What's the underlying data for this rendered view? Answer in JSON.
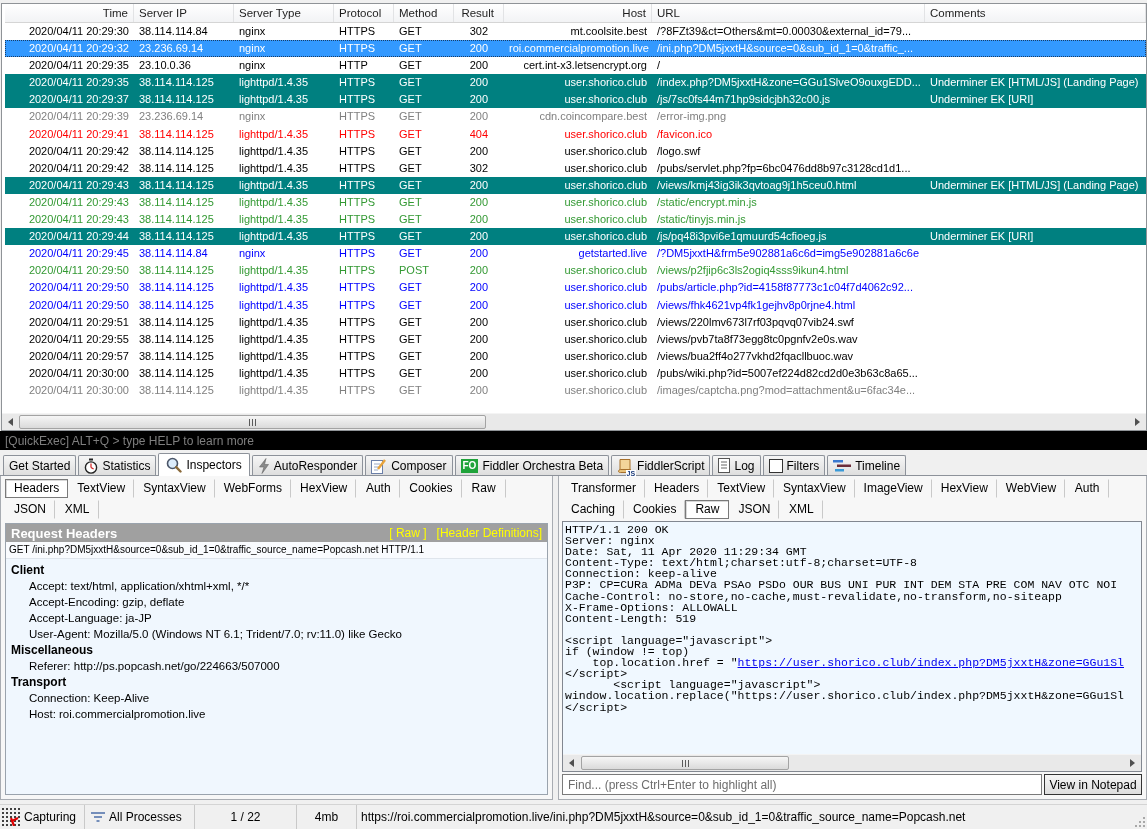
{
  "sessions": {
    "columns": [
      "Time",
      "Server IP",
      "Server Type",
      "Protocol",
      "Method",
      "Result",
      "Host",
      "URL",
      "Comments"
    ],
    "rows": [
      {
        "time": "2020/04/11 20:29:30",
        "server_ip": "38.114.114.84",
        "server_type": "nginx",
        "protocol": "HTTPS",
        "method": "GET",
        "result": "302",
        "host": "mt.coolsite.best",
        "url": "/?8FZt39&ct=Others&mt=0.00030&external_id=79...",
        "selected": false,
        "marked": false,
        "color": "#000000"
      },
      {
        "time": "2020/04/11 20:29:32",
        "server_ip": "23.236.69.14",
        "server_type": "nginx",
        "protocol": "HTTPS",
        "method": "GET",
        "result": "200",
        "host": "roi.commercialpromotion.live",
        "url": "/ini.php?DM5jxxtH&source=0&sub_id_1=0&traffic_...",
        "selected": true,
        "marked": false
      },
      {
        "time": "2020/04/11 20:29:35",
        "server_ip": "23.10.0.36",
        "server_type": "nginx",
        "protocol": "HTTP",
        "method": "GET",
        "result": "200",
        "host": "cert.int-x3.letsencrypt.org",
        "url": "/",
        "selected": false,
        "marked": false,
        "color": "#000000"
      },
      {
        "time": "2020/04/11 20:29:35",
        "server_ip": "38.114.114.125",
        "server_type": "lighttpd/1.4.35",
        "protocol": "HTTPS",
        "method": "GET",
        "result": "200",
        "host": "user.shorico.club",
        "url": "/index.php?DM5jxxtH&zone=GGu1SlveO9ouxgEDD...",
        "comments": "Underminer EK [HTML/JS] (Landing Page)",
        "selected": false,
        "marked": true,
        "color": "#008080"
      },
      {
        "time": "2020/04/11 20:29:37",
        "server_ip": "38.114.114.125",
        "server_type": "lighttpd/1.4.35",
        "protocol": "HTTPS",
        "method": "GET",
        "result": "200",
        "host": "user.shorico.club",
        "url": "/js/7sc0fs44m71hp9sidcjbh32c00.js",
        "comments": "Underminer EK [URI]",
        "selected": false,
        "marked": true,
        "color": "#008080"
      },
      {
        "time": "2020/04/11 20:29:39",
        "server_ip": "23.236.69.14",
        "server_type": "nginx",
        "protocol": "HTTPS",
        "method": "GET",
        "result": "200",
        "host": "cdn.coincompare.best",
        "url": "/error-img.png",
        "selected": false,
        "marked": false,
        "color": "#808080"
      },
      {
        "time": "2020/04/11 20:29:41",
        "server_ip": "38.114.114.125",
        "server_type": "lighttpd/1.4.35",
        "protocol": "HTTPS",
        "method": "GET",
        "result": "404",
        "host": "user.shorico.club",
        "url": "/favicon.ico",
        "selected": false,
        "marked": false,
        "color": "#ff0000"
      },
      {
        "time": "2020/04/11 20:29:42",
        "server_ip": "38.114.114.125",
        "server_type": "lighttpd/1.4.35",
        "protocol": "HTTPS",
        "method": "GET",
        "result": "200",
        "host": "user.shorico.club",
        "url": "/logo.swf",
        "selected": false,
        "marked": false,
        "color": "#000000"
      },
      {
        "time": "2020/04/11 20:29:42",
        "server_ip": "38.114.114.125",
        "server_type": "lighttpd/1.4.35",
        "protocol": "HTTPS",
        "method": "GET",
        "result": "302",
        "host": "user.shorico.club",
        "url": "/pubs/servlet.php?fp=6bc0476dd8b97c3128cd1d1...",
        "selected": false,
        "marked": false,
        "color": "#000000"
      },
      {
        "time": "2020/04/11 20:29:43",
        "server_ip": "38.114.114.125",
        "server_type": "lighttpd/1.4.35",
        "protocol": "HTTPS",
        "method": "GET",
        "result": "200",
        "host": "user.shorico.club",
        "url": "/views/kmj43ig3ik3qvtoag9j1h5ceu0.html",
        "comments": "Underminer EK [HTML/JS] (Landing Page)",
        "selected": false,
        "marked": true,
        "color": "#008080"
      },
      {
        "time": "2020/04/11 20:29:43",
        "server_ip": "38.114.114.125",
        "server_type": "lighttpd/1.4.35",
        "protocol": "HTTPS",
        "method": "GET",
        "result": "200",
        "host": "user.shorico.club",
        "url": "/static/encrypt.min.js",
        "selected": false,
        "marked": false,
        "color": "#339933"
      },
      {
        "time": "2020/04/11 20:29:43",
        "server_ip": "38.114.114.125",
        "server_type": "lighttpd/1.4.35",
        "protocol": "HTTPS",
        "method": "GET",
        "result": "200",
        "host": "user.shorico.club",
        "url": "/static/tinyjs.min.js",
        "selected": false,
        "marked": false,
        "color": "#339933"
      },
      {
        "time": "2020/04/11 20:29:44",
        "server_ip": "38.114.114.125",
        "server_type": "lighttpd/1.4.35",
        "protocol": "HTTPS",
        "method": "GET",
        "result": "200",
        "host": "user.shorico.club",
        "url": "/js/pq48i3pvi6e1qmuurd54cfioeg.js",
        "comments": "Underminer EK [URI]",
        "selected": false,
        "marked": true,
        "color": "#008080"
      },
      {
        "time": "2020/04/11 20:29:45",
        "server_ip": "38.114.114.84",
        "server_type": "nginx",
        "protocol": "HTTPS",
        "method": "GET",
        "result": "200",
        "host": "getstarted.live",
        "url": "/?DM5jxxtH&frm5e902881a6c6d=img5e902881a6c6e",
        "selected": false,
        "marked": false,
        "color": "#0000ff"
      },
      {
        "time": "2020/04/11 20:29:50",
        "server_ip": "38.114.114.125",
        "server_type": "lighttpd/1.4.35",
        "protocol": "HTTPS",
        "method": "POST",
        "result": "200",
        "host": "user.shorico.club",
        "url": "/views/p2fjip6c3ls2ogiq4sss9ikun4.html",
        "selected": false,
        "marked": false,
        "color": "#339933"
      },
      {
        "time": "2020/04/11 20:29:50",
        "server_ip": "38.114.114.125",
        "server_type": "lighttpd/1.4.35",
        "protocol": "HTTPS",
        "method": "GET",
        "result": "200",
        "host": "user.shorico.club",
        "url": "/pubs/article.php?id=4158f87773c1c04f7d4062c92...",
        "selected": false,
        "marked": false,
        "color": "#0000ff"
      },
      {
        "time": "2020/04/11 20:29:50",
        "server_ip": "38.114.114.125",
        "server_type": "lighttpd/1.4.35",
        "protocol": "HTTPS",
        "method": "GET",
        "result": "200",
        "host": "user.shorico.club",
        "url": "/views/fhk4621vp4fk1gejhv8p0rjne4.html",
        "selected": false,
        "marked": false,
        "color": "#0000ff"
      },
      {
        "time": "2020/04/11 20:29:51",
        "server_ip": "38.114.114.125",
        "server_type": "lighttpd/1.4.35",
        "protocol": "HTTPS",
        "method": "GET",
        "result": "200",
        "host": "user.shorico.club",
        "url": "/views/220lmv673l7rf03pqvq07vib24.swf",
        "selected": false,
        "marked": false,
        "color": "#000000"
      },
      {
        "time": "2020/04/11 20:29:55",
        "server_ip": "38.114.114.125",
        "server_type": "lighttpd/1.4.35",
        "protocol": "HTTPS",
        "method": "GET",
        "result": "200",
        "host": "user.shorico.club",
        "url": "/views/pvb7ta8f73egg8tc0pgnfv2e0s.wav",
        "selected": false,
        "marked": false,
        "color": "#000000"
      },
      {
        "time": "2020/04/11 20:29:57",
        "server_ip": "38.114.114.125",
        "server_type": "lighttpd/1.4.35",
        "protocol": "HTTPS",
        "method": "GET",
        "result": "200",
        "host": "user.shorico.club",
        "url": "/views/bua2ff4o277vkhd2fqacllbuoc.wav",
        "selected": false,
        "marked": false,
        "color": "#000000"
      },
      {
        "time": "2020/04/11 20:30:00",
        "server_ip": "38.114.114.125",
        "server_type": "lighttpd/1.4.35",
        "protocol": "HTTPS",
        "method": "GET",
        "result": "200",
        "host": "user.shorico.club",
        "url": "/pubs/wiki.php?id=5007ef224d82cd2d0e3b63c8a65...",
        "selected": false,
        "marked": false,
        "color": "#000000"
      },
      {
        "time": "2020/04/11 20:30:00",
        "server_ip": "38.114.114.125",
        "server_type": "lighttpd/1.4.35",
        "protocol": "HTTPS",
        "method": "GET",
        "result": "200",
        "host": "user.shorico.club",
        "url": "/images/captcha.png?mod=attachment&u=6fac34e...",
        "selected": false,
        "marked": false,
        "color": "#808080"
      }
    ]
  },
  "quickexec": {
    "placeholder": "[QuickExec] ALT+Q > type HELP to learn more"
  },
  "main_tabs": [
    {
      "label": "Get Started",
      "selected": false
    },
    {
      "label": "Statistics",
      "selected": false
    },
    {
      "label": "Inspectors",
      "selected": true
    },
    {
      "label": "AutoResponder",
      "selected": false
    },
    {
      "label": "Composer",
      "selected": false
    },
    {
      "label": "Fiddler Orchestra Beta",
      "badge": "FO",
      "selected": false
    },
    {
      "label": "FiddlerScript",
      "icon_label": "JS",
      "selected": false
    },
    {
      "label": "Log",
      "selected": false
    },
    {
      "label": "Filters",
      "selected": false
    },
    {
      "label": "Timeline",
      "selected": false
    }
  ],
  "request_tab_rows": [
    [
      {
        "label": "Headers",
        "selected": true
      },
      {
        "label": "TextView",
        "selected": false
      },
      {
        "label": "SyntaxView",
        "selected": false
      },
      {
        "label": "WebForms",
        "selected": false
      },
      {
        "label": "HexView",
        "selected": false
      },
      {
        "label": "Auth",
        "selected": false
      },
      {
        "label": "Cookies",
        "selected": false
      },
      {
        "label": "Raw",
        "selected": false
      }
    ],
    [
      {
        "label": "JSON",
        "selected": false
      },
      {
        "label": "XML",
        "selected": false
      }
    ]
  ],
  "request_headers": {
    "title": "Request Headers",
    "links": [
      "[ Raw ]",
      "[Header Definitions]"
    ],
    "request_line": "GET /ini.php?DM5jxxtH&source=0&sub_id_1=0&traffic_source_name=Popcash.net HTTP/1.1",
    "groups": [
      {
        "name": "Client",
        "children": [
          {
            "text": "Accept: text/html, application/xhtml+xml, */*"
          },
          {
            "text": "Accept-Encoding: gzip, deflate"
          },
          {
            "text": "Accept-Language: ja-JP"
          },
          {
            "text": "User-Agent: Mozilla/5.0 (Windows NT 6.1; Trident/7.0; rv:11.0) like Gecko"
          }
        ]
      },
      {
        "name": "Miscellaneous",
        "children": [
          {
            "text": "Referer: http://ps.popcash.net/go/224663/507000"
          }
        ]
      },
      {
        "name": "Transport",
        "children": [
          {
            "text": "Connection: Keep-Alive"
          },
          {
            "text": "Host: roi.commercialpromotion.live"
          }
        ]
      }
    ]
  },
  "response_tab_rows": [
    [
      {
        "label": "Transformer",
        "selected": false
      },
      {
        "label": "Headers",
        "selected": false
      },
      {
        "label": "TextView",
        "selected": false
      },
      {
        "label": "SyntaxView",
        "selected": false
      },
      {
        "label": "ImageView",
        "selected": false
      },
      {
        "label": "HexView",
        "selected": false
      },
      {
        "label": "WebView",
        "selected": false
      },
      {
        "label": "Auth",
        "selected": false
      }
    ],
    [
      {
        "label": "Caching",
        "selected": false
      },
      {
        "label": "Cookies",
        "selected": false
      },
      {
        "label": "Raw",
        "selected": true
      },
      {
        "label": "JSON",
        "selected": false
      },
      {
        "label": "XML",
        "selected": false
      }
    ]
  ],
  "response_raw": {
    "headers": [
      "HTTP/1.1 200 OK",
      "Server: nginx",
      "Date: Sat, 11 Apr 2020 11:29:34 GMT",
      "Content-Type: text/html;charset:utf-8;charset=UTF-8",
      "Connection: keep-alive",
      "P3P: CP=CURa ADMa DEVa PSAo PSDo OUR BUS UNI PUR INT DEM STA PRE COM NAV OTC NOI",
      "Cache-Control: no-store,no-cache,must-revalidate,no-transform,no-siteapp",
      "X-Frame-Options: ALLOWALL",
      "Content-Length: 519"
    ],
    "body": [
      {
        "text": "<script language=\"javascript\">"
      },
      {
        "text": "if (window != top)"
      },
      {
        "text": "    top.location.href = \"",
        "link": "https://user.shorico.club/index.php?DM5jxxtH&zone=GGu1Sl"
      },
      {
        "text": "</script>"
      },
      {
        "text": "       <script language=\"javascript\">"
      },
      {
        "text": "window.location.replace(\"https://user.shorico.club/index.php?DM5jxxtH&zone=GGu1Sl"
      },
      {
        "text": "</script>"
      }
    ]
  },
  "find_field": {
    "placeholder": "Find... (press Ctrl+Enter to highlight all)"
  },
  "notepad_button": {
    "label": "View in Notepad"
  },
  "status_bar": {
    "capturing": "Capturing",
    "processes": "All Processes",
    "count": "1 / 22",
    "memory": "4mb",
    "url": "https://roi.commercialpromotion.live/ini.php?DM5jxxtH&source=0&sub_id_1=0&traffic_source_name=Popcash.net"
  }
}
